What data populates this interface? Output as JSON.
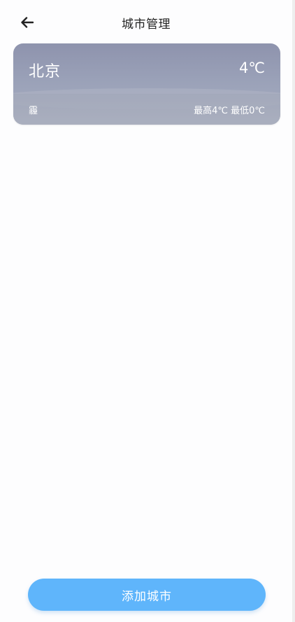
{
  "header": {
    "back_icon": "arrow-left-icon",
    "title": "城市管理"
  },
  "cities": [
    {
      "name": "北京",
      "temperature": "4℃",
      "weather": "霾",
      "high": "最高4℃",
      "low": "最低0℃"
    }
  ],
  "actions": {
    "add_city_label": "添加城市"
  },
  "colors": {
    "accent_button": "#5fb5fb",
    "card_bg_top": "#8e93ad",
    "card_bg_bottom": "#a7aec0",
    "title_text": "#222222"
  }
}
